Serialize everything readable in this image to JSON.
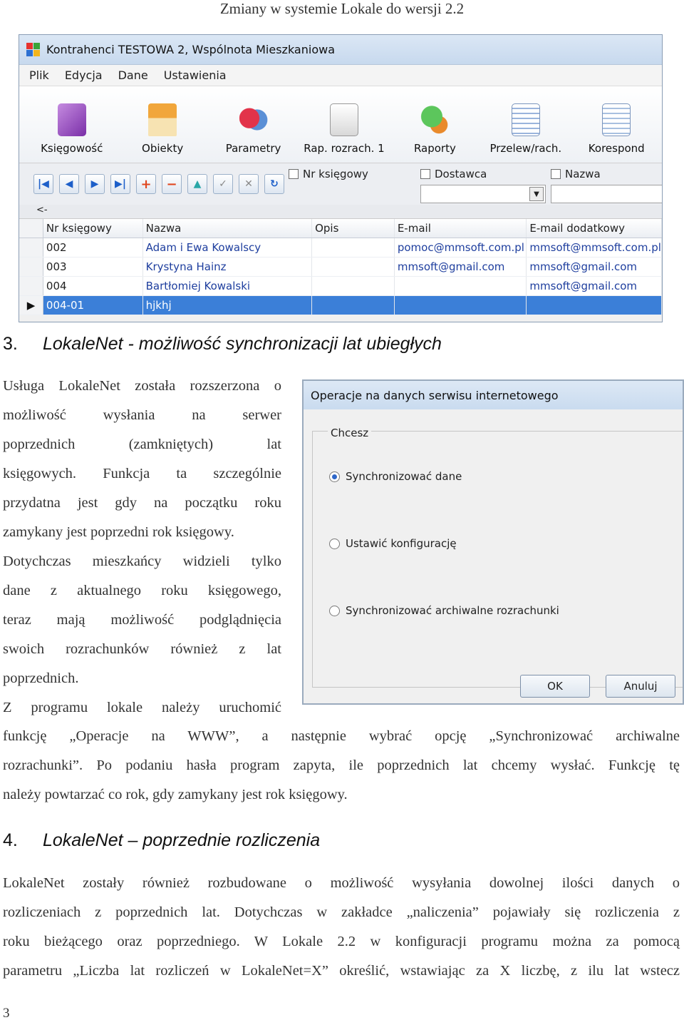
{
  "header": {
    "title": "Zmiany w systemie Lokale do wersji 2.2"
  },
  "window": {
    "title": "Kontrahenci TESTOWA 2, Wspólnota Mieszkaniowa",
    "menu": [
      "Plik",
      "Edycja",
      "Dane",
      "Ustawienia"
    ],
    "toolbar": [
      "Księgowość",
      "Obiekty",
      "Parametry",
      "Rap. rozrach. 1",
      "Raporty",
      "Przelew/rach.",
      "Korespond"
    ],
    "nav_icons": [
      "first-icon",
      "prev-icon",
      "next-icon",
      "last-icon",
      "add-icon",
      "delete-icon",
      "up-icon",
      "confirm-icon",
      "cancel-icon",
      "refresh-icon"
    ],
    "filters": [
      "Nr księgowy",
      "Dostawca",
      "Nazwa"
    ],
    "back_arrow": "<-",
    "columns": [
      "Nr księgowy",
      "Nazwa",
      "Opis",
      "E-mail",
      "E-mail dodatkowy"
    ],
    "rows": [
      [
        "002",
        "Adam i Ewa Kowalscy",
        "",
        "pomoc@mmsoft.com.pl",
        "mmsoft@mmsoft.com.pl"
      ],
      [
        "003",
        "Krystyna Hainz",
        "",
        "mmsoft@gmail.com",
        "mmsoft@gmail.com"
      ],
      [
        "004",
        "Bartłomiej Kowalski",
        "",
        "",
        "mmsoft@gmail.com"
      ],
      [
        "004-01",
        "hjkhj",
        "",
        "",
        ""
      ]
    ],
    "selected_marker": "▶"
  },
  "section3": {
    "number": "3.",
    "title": "LokaleNet - możliwość synchronizacji lat ubiegłych",
    "narrow_lines": [
      "Usługa LokaleNet została rozszerzona o",
      "możliwość wysłania na serwer",
      "poprzednich (zamkniętych) lat",
      "księgowych. Funkcja ta szczególnie",
      "przydatna jest gdy na początku roku",
      "zamykany jest poprzedni rok księgowy.",
      "Dotychczas mieszkańcy widzieli tylko",
      "dane z aktualnego roku księgowego,",
      "teraz mają możliwość podglądnięcia",
      "swoich rozrachunków również z lat",
      "poprzednich.",
      "Z programu lokale należy uruchomić"
    ],
    "wide_lines": [
      "funkcję „Operacje na WWW”, a następnie wybrać opcję „Synchronizować archiwalne",
      "rozrachunki”. Po podaniu hasła program zapyta, ile poprzednich lat chcemy wysłać. Funkcję tę",
      "należy powtarzać co rok, gdy zamykany jest rok księgowy."
    ]
  },
  "dialog": {
    "title": "Operacje na danych serwisu internetowego",
    "group_label": "Chcesz",
    "options": [
      "Synchronizować dane",
      "Ustawić konfigurację",
      "Synchronizować archiwalne rozrachunki"
    ],
    "selected_index": 0,
    "ok": "OK",
    "cancel": "Anuluj"
  },
  "section4": {
    "number": "4.",
    "title": "LokaleNet – poprzednie rozliczenia",
    "lines": [
      "LokaleNet zostały również rozbudowane o możliwość wysyłania dowolnej ilości danych o",
      "rozliczeniach z poprzednich lat. Dotychczas w zakładce „naliczenia” pojawiały się rozliczenia z",
      "roku bieżącego oraz poprzedniego. W Lokale 2.2 w konfiguracji programu można za pomocą",
      "parametru „Liczba lat rozliczeń w LokaleNet=X” określić, wstawiając za X liczbę, z ilu lat wstecz"
    ]
  },
  "footer": {
    "page": "3"
  }
}
